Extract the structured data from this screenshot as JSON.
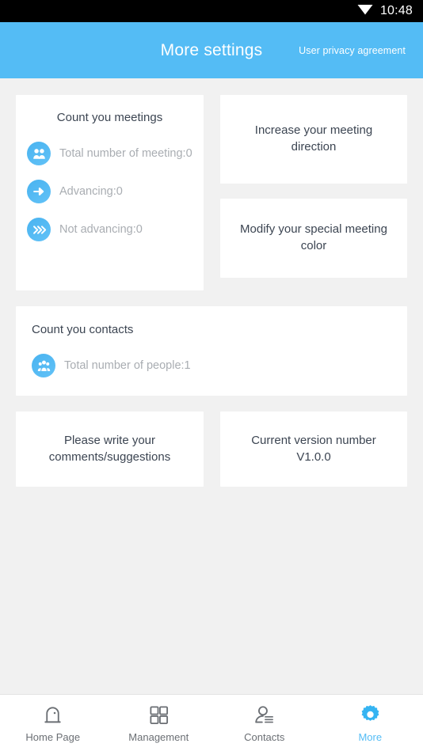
{
  "status_bar": {
    "wifi_icon": "wifi-icon",
    "time": "10:48"
  },
  "header": {
    "title": "More settings",
    "privacy_link": "User privacy agreement",
    "background_color": "#54bcf5",
    "text_color": "#ffffff"
  },
  "meetings_card": {
    "title": "Count you meetings",
    "stats": [
      {
        "icon": "group-people-icon",
        "label": "Total number of meeting:0"
      },
      {
        "icon": "arrow-right-icon",
        "label": "Advancing:0"
      },
      {
        "icon": "double-chevron-right-icon",
        "label": "Not advancing:0"
      }
    ]
  },
  "action_cards": {
    "increase_direction": "Increase your meeting direction",
    "modify_color": "Modify your special meeting color",
    "comments": "Please write your comments/suggestions",
    "version": "Current version number V1.0.0"
  },
  "contacts_card": {
    "title": "Count you contacts",
    "stats": [
      {
        "icon": "group-people-icon",
        "label": "Total number of people:1"
      }
    ]
  },
  "bottom_nav": {
    "items": [
      {
        "icon": "home-door-icon",
        "label": "Home Page",
        "active": false
      },
      {
        "icon": "grid-squares-icon",
        "label": "Management",
        "active": false
      },
      {
        "icon": "contacts-person-icon",
        "label": "Contacts",
        "active": false
      },
      {
        "icon": "gear-icon",
        "label": "More",
        "active": true
      }
    ],
    "active_color": "#54bcf5",
    "inactive_color": "#6b6f74"
  }
}
